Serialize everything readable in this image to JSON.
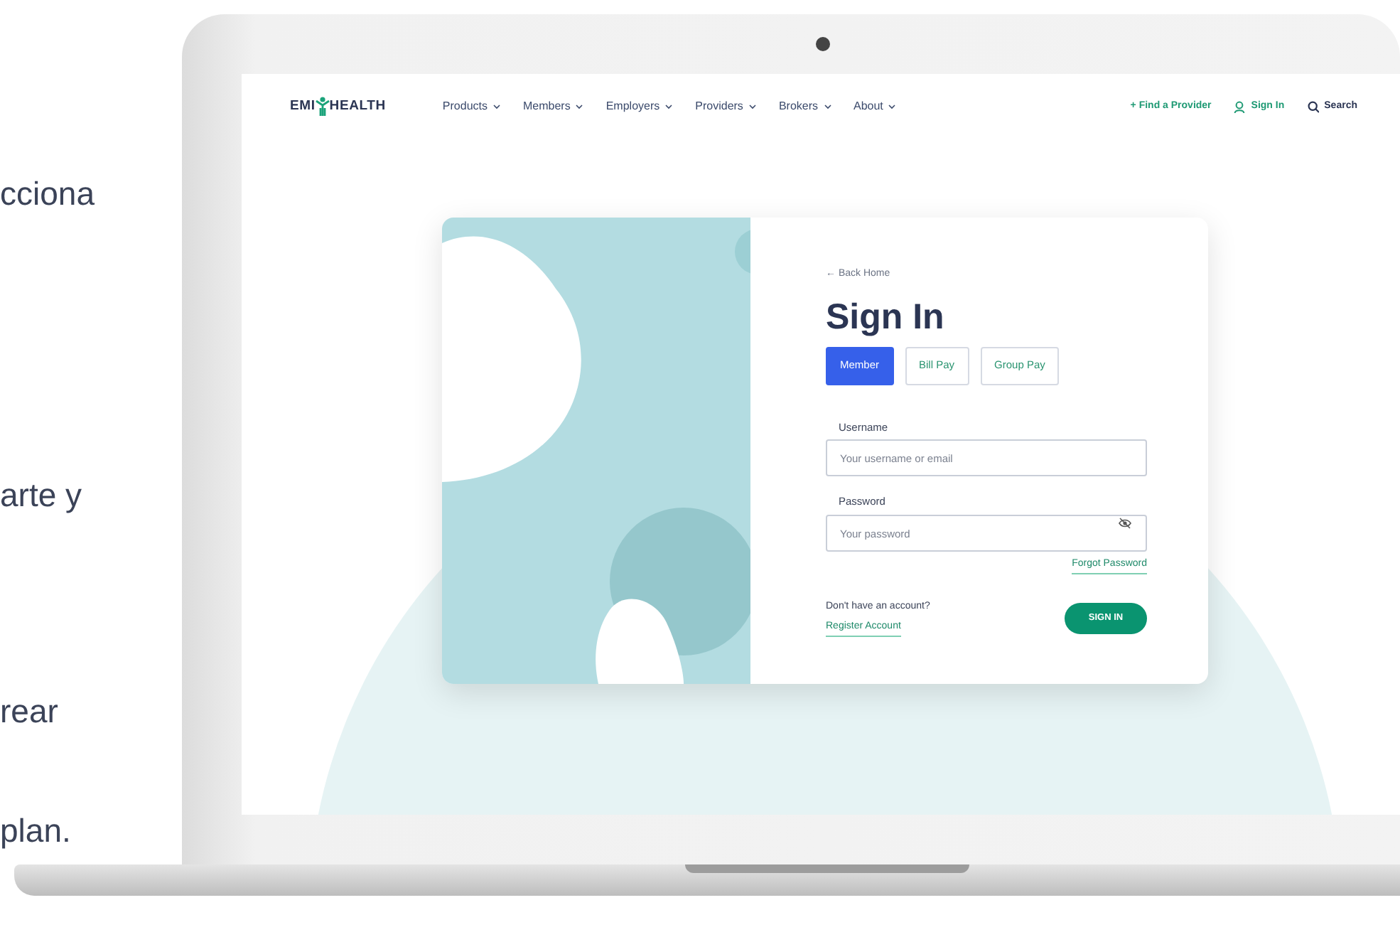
{
  "side_text": [
    "cciona",
    "arte y",
    "rear",
    "plan."
  ],
  "nav": {
    "logo": {
      "left": "EMI",
      "right": "HEALTH"
    },
    "menu": [
      {
        "label": "Products"
      },
      {
        "label": "Members"
      },
      {
        "label": "Employers"
      },
      {
        "label": "Providers"
      },
      {
        "label": "Brokers"
      },
      {
        "label": "About"
      }
    ],
    "actions": [
      {
        "kind": "plus",
        "label": "+ Find a Provider"
      },
      {
        "kind": "user",
        "label": "Sign In"
      },
      {
        "kind": "search",
        "label": "Search"
      }
    ]
  },
  "signin": {
    "back_link": "← Back Home",
    "title": "Sign In",
    "tabs": [
      {
        "label": "Member",
        "selected": true
      },
      {
        "label": "Bill Pay",
        "selected": false
      },
      {
        "label": "Group Pay",
        "selected": false
      }
    ],
    "fields": [
      {
        "kind": "text",
        "label": "Username",
        "placeholder": "Your username or email"
      },
      {
        "kind": "password",
        "label": "Password",
        "placeholder": "Your password"
      }
    ],
    "forgot": "Forgot Password",
    "register_prompt": "Don't have an account?",
    "register_link": "Register Account",
    "submit": "SIGN IN"
  }
}
